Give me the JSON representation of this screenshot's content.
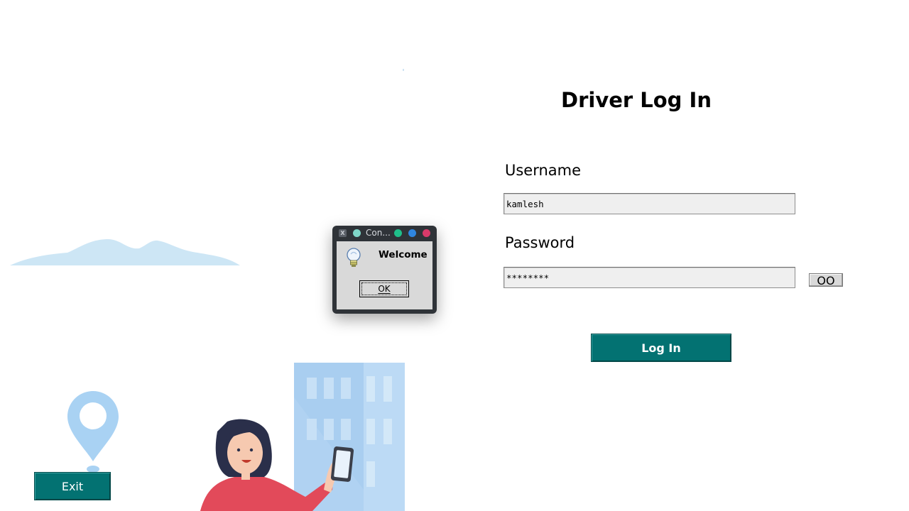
{
  "form": {
    "title": "Driver Log In",
    "username_label": "Username",
    "username_value": "kamlesh",
    "password_label": "Password",
    "password_value": "********",
    "show_password_label": "OO",
    "login_label": "Log In"
  },
  "exit_label": "Exit",
  "dialog": {
    "title": "Con...",
    "message": "Welcome",
    "ok_label": "OK",
    "icon": "lightbulb-icon"
  },
  "colors": {
    "accent": "#037272",
    "dot_teal": "#7fd6c8",
    "dot_green": "#1fbf8a",
    "dot_blue": "#2f86e0",
    "dot_red": "#d93a6a"
  }
}
